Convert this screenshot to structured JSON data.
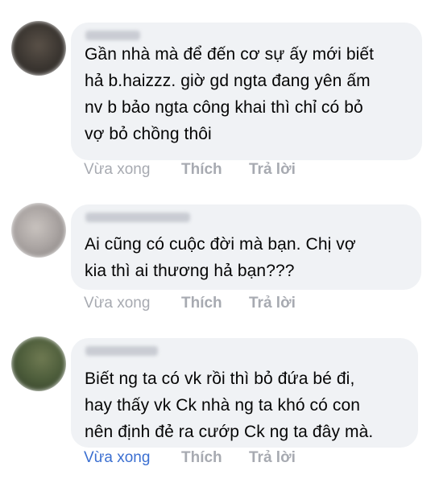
{
  "comments": [
    {
      "text": "Gần nhà mà để đến cơ sự ấy mới biết\nhả b.haizzz. giờ gd ngta đang yên ấm\nnv b bảo ngta công khai thì chỉ có bỏ\nvợ bỏ chồng thôi",
      "time": "Vừa xong",
      "like": "Thích",
      "reply": "Trả lời"
    },
    {
      "text": "Ai cũng có cuộc đời mà bạn.  Chị vợ\nkia thì ai thương hả bạn???",
      "time": "Vừa xong",
      "like": "Thích",
      "reply": "Trả lời"
    },
    {
      "text": "Biết ng ta có vk rồi thì bỏ đứa bé đi,\nhay thấy vk Ck nhà ng ta khó có con\nnên định đẻ ra cướp Ck ng ta đây mà.",
      "time": "Vừa xong",
      "like": "Thích",
      "reply": "Trả lời"
    }
  ],
  "colors": {
    "bubble": "#f0f2f5",
    "text": "#050505",
    "muted": "#a7aab1",
    "recent_time": "#3b6fd1"
  }
}
